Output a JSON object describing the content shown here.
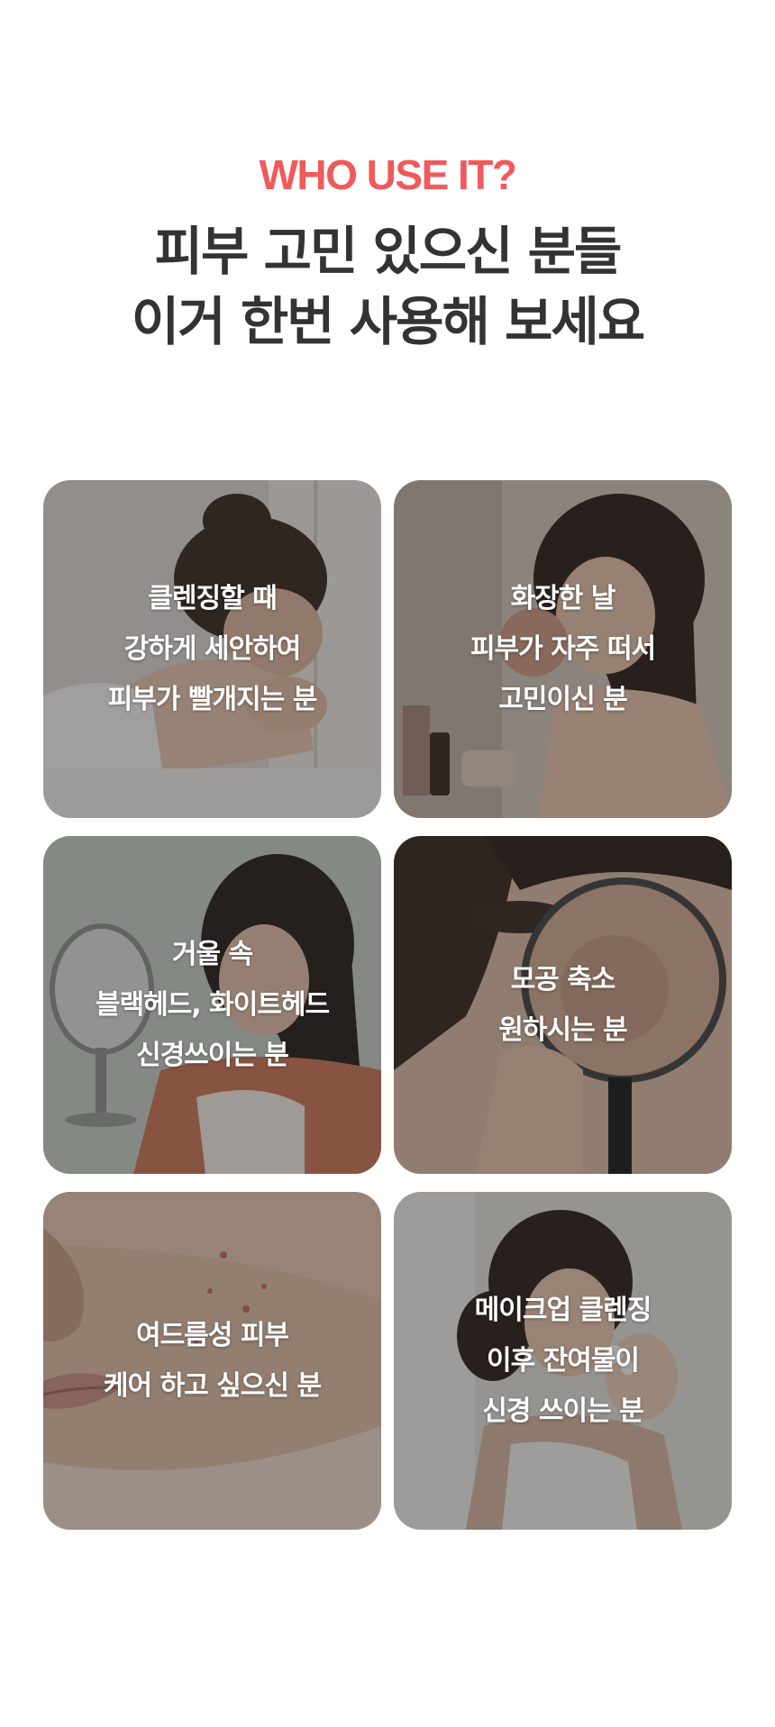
{
  "header": {
    "eyebrow": "WHO USE IT?",
    "headline_line1": "피부 고민 있으신 분들",
    "headline_line2": "이거 한번 사용해 보세요"
  },
  "accent_color": "#f05a5a",
  "headline_color": "#333333",
  "cards": [
    {
      "lines": [
        "클렌징할 때",
        "강하게 세안하여",
        "피부가 빨개지는 분"
      ]
    },
    {
      "lines": [
        "화장한 날",
        "피부가 자주 떠서",
        "고민이신 분"
      ]
    },
    {
      "lines": [
        "거울 속",
        "블랙헤드, 화이트헤드",
        "신경쓰이는 분"
      ]
    },
    {
      "lines": [
        "모공 축소",
        "원하시는 분"
      ]
    },
    {
      "lines": [
        "여드름성 피부",
        "케어 하고 싶으신 분"
      ]
    },
    {
      "lines": [
        "메이크업 클렌징",
        "이후 잔여물이",
        "신경 쓰이는 분"
      ]
    }
  ]
}
